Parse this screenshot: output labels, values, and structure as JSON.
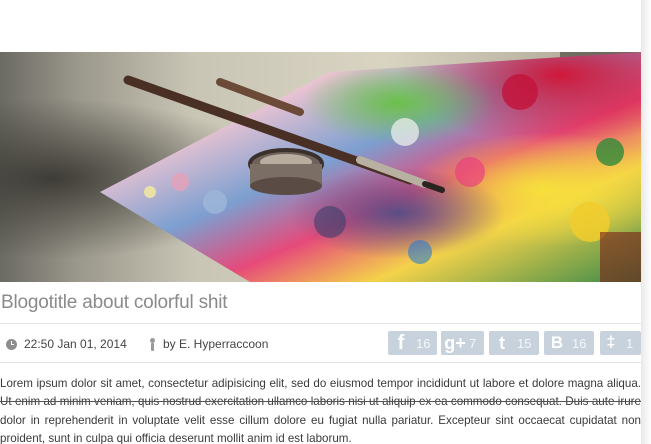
{
  "post": {
    "title": "Blogotitle about colorful shit",
    "date": "22:50 Jan 01, 2014",
    "author": "by E. Hyperraccoon",
    "body": "Lorem ipsum dolor sit amet, consectetur adipisicing elit, sed do eiusmod tempor incididunt ut labore et dolore magna aliqua. Ut enim ad minim veniam, quis nostrud exercitation ullamco laboris nisi ut aliquip ex ea commodo consequat. Duis aute irure dolor in reprehenderit in voluptate velit esse cillum dolore eu fugiat nulla pariatur. Excepteur sint occaecat cupidatat non proident, sunt in culpa qui officia deserunt mollit anim id est laborum."
  },
  "shares": {
    "facebook": {
      "icon": "facebook-icon",
      "glyph": "f",
      "count": "16"
    },
    "googleplus": {
      "icon": "google-plus-icon",
      "glyph": "g+",
      "count": "7"
    },
    "twitter": {
      "icon": "twitter-icon",
      "glyph": "t",
      "count": "15"
    },
    "vkontakte": {
      "icon": "vk-b-icon",
      "glyph": "B",
      "count": "16"
    },
    "other": {
      "icon": "runner-icon",
      "glyph": "‡",
      "count": "1"
    }
  },
  "hero": {
    "icon": "paint-palette-photo"
  }
}
